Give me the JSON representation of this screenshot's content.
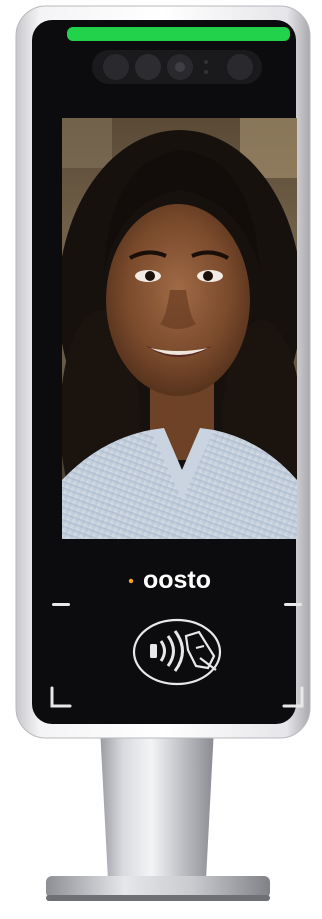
{
  "device": {
    "brand_logo": "oosto",
    "status_led_color": "#22d24a",
    "logo_accent_color": "#f5a623",
    "icons": {
      "status_led": "status-led-bar",
      "camera_array": "camera-sensor-array",
      "nfc_reader": "contactless-nfc-icon",
      "corner_markers": "scan-frame-corner-icon"
    },
    "screen": {
      "content": "face-capture-photo"
    }
  }
}
